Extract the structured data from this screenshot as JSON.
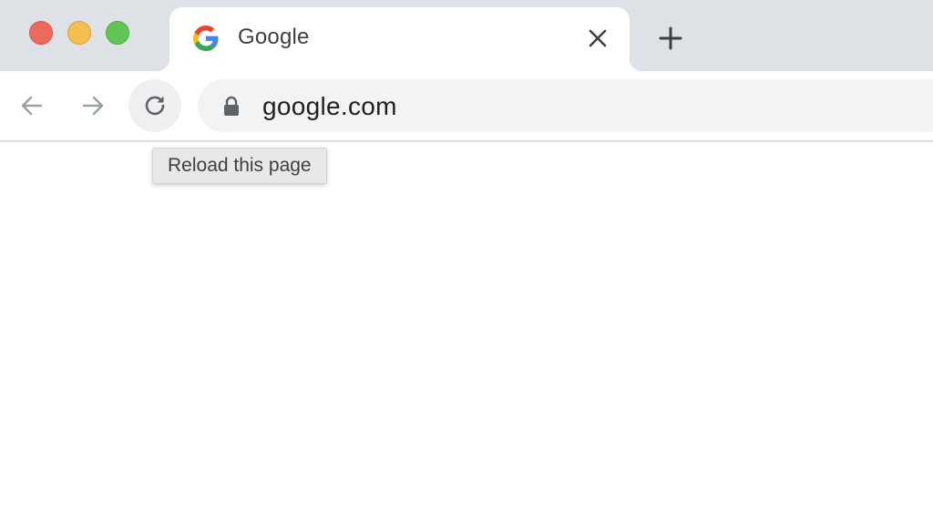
{
  "window": {
    "traffic_lights": {
      "close_color": "#ed6a5e",
      "minimize_color": "#f5bf4f",
      "maximize_color": "#61c554"
    }
  },
  "tab": {
    "title": "Google",
    "favicon": "google-g-icon",
    "close_icon": "close-icon"
  },
  "new_tab": {
    "icon": "plus-icon"
  },
  "toolbar": {
    "back_icon": "arrow-left-icon",
    "forward_icon": "arrow-right-icon",
    "reload_icon": "reload-icon"
  },
  "omnibox": {
    "lock_icon": "lock-icon",
    "url": "google.com"
  },
  "tooltip": {
    "text": "Reload this page"
  },
  "colors": {
    "tabstrip_bg": "#dee1e6",
    "omnibox_bg": "#f1f3f4",
    "text": "#3c4043"
  }
}
